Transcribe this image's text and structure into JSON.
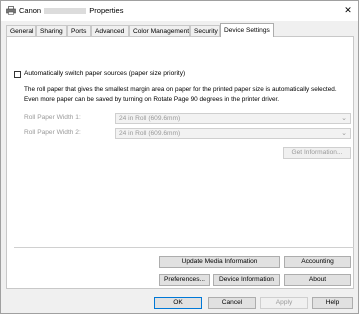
{
  "window": {
    "title_prefix": "Canon",
    "title_suffix": "Properties",
    "close_glyph": "✕"
  },
  "tabs": [
    {
      "label": "General"
    },
    {
      "label": "Sharing"
    },
    {
      "label": "Ports"
    },
    {
      "label": "Advanced"
    },
    {
      "label": "Color Management"
    },
    {
      "label": "Security"
    },
    {
      "label": "Device Settings"
    }
  ],
  "device_settings": {
    "auto_switch_label": "Automatically switch paper sources (paper size priority)",
    "auto_switch_checked": false,
    "description_line1": "The roll paper that gives the smallest margin area on paper for the printed paper size is automatically selected.",
    "description_line2": "Even more paper can be saved by turning on Rotate Page 90 degrees in the printer driver.",
    "roll_paper_width_1": {
      "label": "Roll Paper Width 1:",
      "value": "24 in Roll (609.6mm)"
    },
    "roll_paper_width_2": {
      "label": "Roll Paper Width 2:",
      "value": "24 in Roll (609.6mm)"
    },
    "get_information_label": "Get Information...",
    "update_media_label": "Update Media Information",
    "accounting_label": "Accounting",
    "preferences_label": "Preferences...",
    "device_information_label": "Device Information",
    "about_label": "About"
  },
  "footer": {
    "ok_label": "OK",
    "cancel_label": "Cancel",
    "apply_label": "Apply",
    "help_label": "Help"
  }
}
